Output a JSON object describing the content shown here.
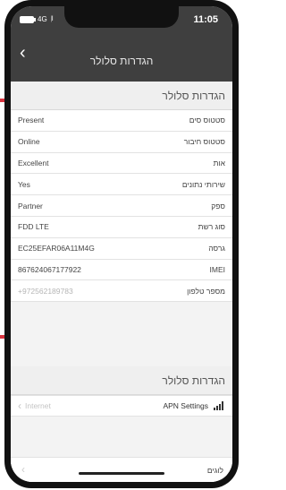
{
  "status_bar": {
    "network": "4G",
    "signal": "|ll",
    "time": "11:05"
  },
  "header": {
    "title": "הגדרות סלולר"
  },
  "section1": {
    "title": "הגדרות סלולר",
    "rows": [
      {
        "label": "סטטוס סים",
        "value": "Present"
      },
      {
        "label": "סטטוס חיבור",
        "value": "Online"
      },
      {
        "label": "אות",
        "value": "Excellent"
      },
      {
        "label": "שירותי נתונים",
        "value": "Yes"
      },
      {
        "label": "ספק",
        "value": "Partner"
      },
      {
        "label": "סוג רשת",
        "value": "FDD LTE"
      },
      {
        "label": "גרסה",
        "value": "EC25EFAR06A11M4G"
      },
      {
        "label": "IMEI",
        "value": "867624067177922"
      },
      {
        "label": "מספר טלפון",
        "value": "+972562189783"
      }
    ]
  },
  "section2": {
    "title": "הגדרות סלולר",
    "apn": {
      "back_label": "Internet",
      "label": "APN Settings"
    }
  },
  "bottom": {
    "label": "לוגים"
  },
  "colors": {
    "header_bg": "#3f3f3f",
    "arrow": "#d9343f"
  }
}
